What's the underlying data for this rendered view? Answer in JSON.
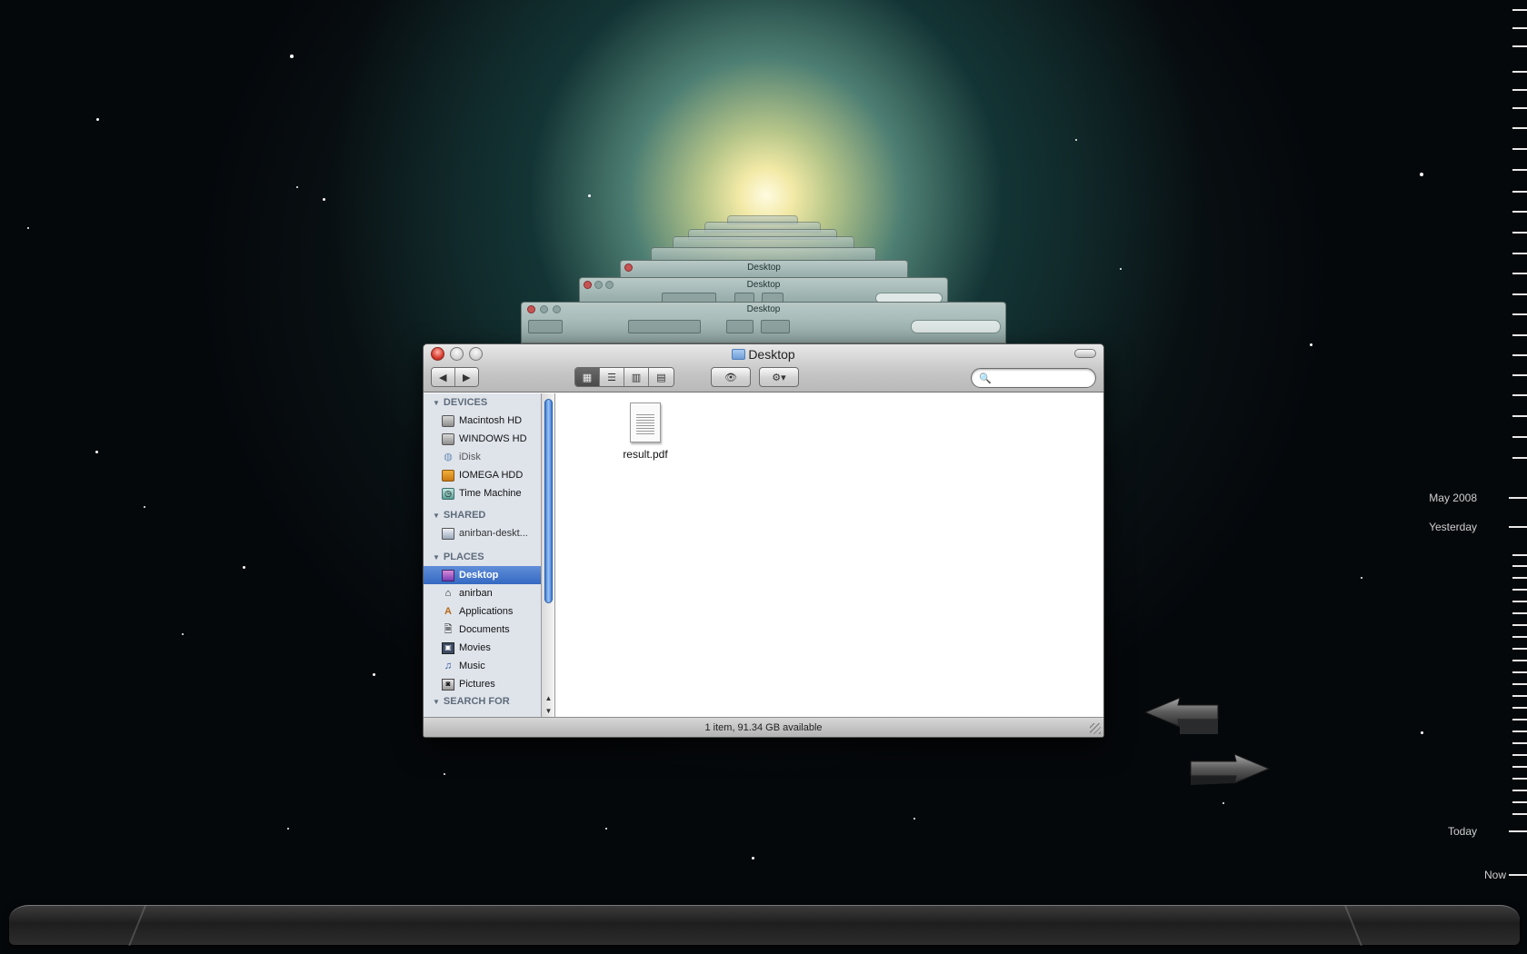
{
  "finder": {
    "title": "Desktop",
    "search": {
      "value": "",
      "placeholder": ""
    },
    "view_buttons": [
      "icon-view",
      "list-view",
      "column-view",
      "coverflow-view"
    ],
    "sidebar": {
      "sections": [
        {
          "label": "DEVICES",
          "items": [
            {
              "label": "Macintosh HD",
              "icon": "hard-disk-icon"
            },
            {
              "label": "WINDOWS HD",
              "icon": "hard-disk-icon"
            },
            {
              "label": "iDisk",
              "icon": "idisk-icon"
            },
            {
              "label": "IOMEGA HDD",
              "icon": "external-disk-icon"
            },
            {
              "label": "Time Machine",
              "icon": "time-machine-disk-icon"
            }
          ]
        },
        {
          "label": "SHARED",
          "items": [
            {
              "label": "anirban-deskt...",
              "icon": "network-computer-icon"
            }
          ]
        },
        {
          "label": "PLACES",
          "items": [
            {
              "label": "Desktop",
              "icon": "desktop-icon",
              "selected": true
            },
            {
              "label": "anirban",
              "icon": "home-icon"
            },
            {
              "label": "Applications",
              "icon": "applications-icon"
            },
            {
              "label": "Documents",
              "icon": "documents-icon"
            },
            {
              "label": "Movies",
              "icon": "movies-icon"
            },
            {
              "label": "Music",
              "icon": "music-icon"
            },
            {
              "label": "Pictures",
              "icon": "pictures-icon"
            }
          ]
        },
        {
          "label": "SEARCH FOR",
          "items": []
        }
      ]
    },
    "files": [
      {
        "name": "result.pdf",
        "icon": "pdf-document-icon"
      }
    ],
    "status": "1 item, 91.34 GB available"
  },
  "stacked_window_title": "Desktop",
  "timeline": {
    "labels": [
      "May 2008",
      "Yesterday",
      "Today",
      "Now"
    ]
  },
  "colors": {
    "selection": "#3569c2",
    "sidebar_bg": "#dfe4eb",
    "timeline_text": "#cfcfcf"
  }
}
